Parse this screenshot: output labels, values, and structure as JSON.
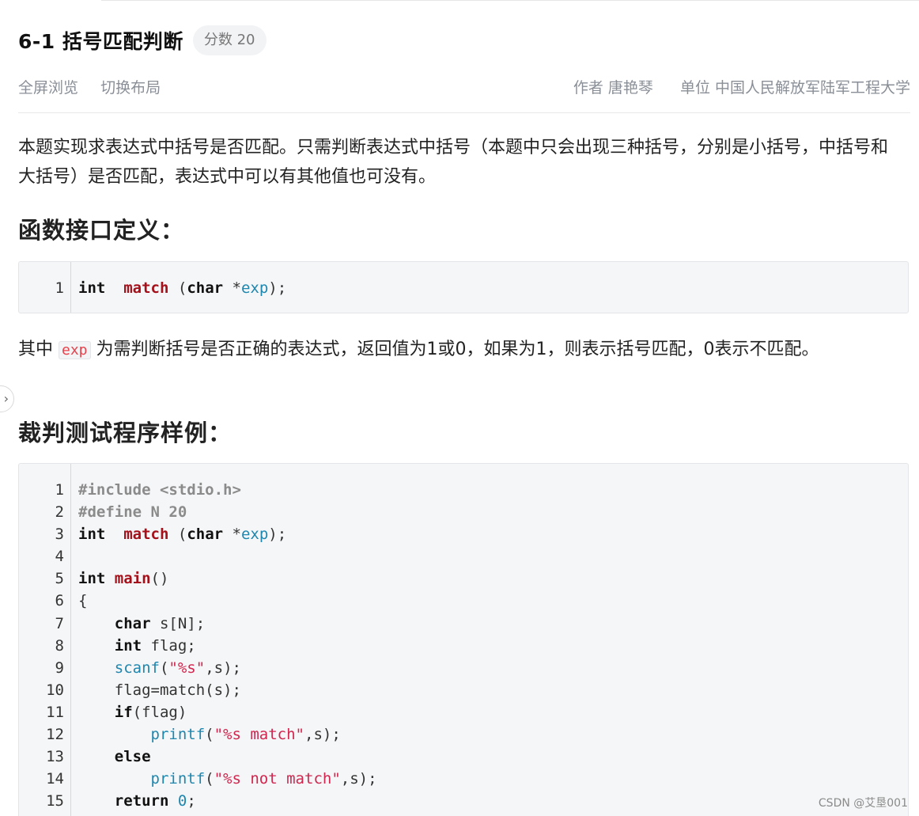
{
  "problem": {
    "title": "6-1 括号匹配判断",
    "score_label": "分数 20"
  },
  "actions": {
    "fullscreen": "全屏浏览",
    "toggle_layout": "切换布局"
  },
  "meta": {
    "author": "作者 唐艳琴",
    "unit": "单位 中国人民解放军陆军工程大学"
  },
  "description": {
    "intro": "本题实现求表达式中括号是否匹配。只需判断表达式中括号（本题中只会出现三种括号，分别是小括号，中括号和大括号）是否匹配，表达式中可以有其他值也可没有。",
    "interface_heading": "函数接口定义：",
    "param_before": "其中 ",
    "param_code": "exp",
    "param_after": " 为需判断括号是否正确的表达式，返回值为1或0，如果为1，则表示括号匹配，0表示不匹配。",
    "sample_heading": "裁判测试程序样例："
  },
  "interface_code": [
    {
      "n": "1",
      "tokens": [
        [
          "k",
          "int"
        ],
        [
          "",
          "  "
        ],
        [
          "f",
          "match"
        ],
        [
          "",
          " ("
        ],
        [
          "k",
          "char"
        ],
        [
          "",
          " *"
        ],
        [
          "b",
          "exp"
        ],
        [
          "",
          ");"
        ]
      ]
    }
  ],
  "sample_code": [
    {
      "n": "1",
      "tokens": [
        [
          "pp",
          "#include <stdio.h>"
        ]
      ]
    },
    {
      "n": "2",
      "tokens": [
        [
          "pp",
          "#define N 20"
        ]
      ]
    },
    {
      "n": "3",
      "tokens": [
        [
          "k",
          "int"
        ],
        [
          "",
          "  "
        ],
        [
          "f",
          "match"
        ],
        [
          "",
          " ("
        ],
        [
          "k",
          "char"
        ],
        [
          "",
          " *"
        ],
        [
          "b",
          "exp"
        ],
        [
          "",
          ");"
        ]
      ]
    },
    {
      "n": "4",
      "tokens": []
    },
    {
      "n": "5",
      "tokens": [
        [
          "k",
          "int"
        ],
        [
          "",
          " "
        ],
        [
          "f",
          "main"
        ],
        [
          "",
          "()"
        ]
      ]
    },
    {
      "n": "6",
      "tokens": [
        [
          "",
          "{"
        ]
      ]
    },
    {
      "n": "7",
      "tokens": [
        [
          "",
          "    "
        ],
        [
          "k",
          "char"
        ],
        [
          "",
          " s[N];"
        ]
      ]
    },
    {
      "n": "8",
      "tokens": [
        [
          "",
          "    "
        ],
        [
          "k",
          "int"
        ],
        [
          "",
          " flag;"
        ]
      ]
    },
    {
      "n": "9",
      "tokens": [
        [
          "",
          "    "
        ],
        [
          "b",
          "scanf"
        ],
        [
          "",
          "("
        ],
        [
          "s",
          "\"%s\""
        ],
        [
          "",
          ",s);"
        ]
      ]
    },
    {
      "n": "10",
      "tokens": [
        [
          "",
          "    flag=match(s);"
        ]
      ]
    },
    {
      "n": "11",
      "tokens": [
        [
          "",
          "    "
        ],
        [
          "k",
          "if"
        ],
        [
          "",
          "(flag)"
        ]
      ]
    },
    {
      "n": "12",
      "tokens": [
        [
          "",
          "        "
        ],
        [
          "b",
          "printf"
        ],
        [
          "",
          "("
        ],
        [
          "s",
          "\"%s match\""
        ],
        [
          "",
          ",s);"
        ]
      ]
    },
    {
      "n": "13",
      "tokens": [
        [
          "",
          "    "
        ],
        [
          "k",
          "else"
        ]
      ]
    },
    {
      "n": "14",
      "tokens": [
        [
          "",
          "        "
        ],
        [
          "b",
          "printf"
        ],
        [
          "",
          "("
        ],
        [
          "s",
          "\"%s not match\""
        ],
        [
          "",
          ",s);"
        ]
      ]
    },
    {
      "n": "15",
      "tokens": [
        [
          "",
          "    "
        ],
        [
          "k",
          "return"
        ],
        [
          "",
          " "
        ],
        [
          "n",
          "0"
        ],
        [
          "",
          ";"
        ]
      ]
    }
  ],
  "watermark": "CSDN @艾垦001"
}
